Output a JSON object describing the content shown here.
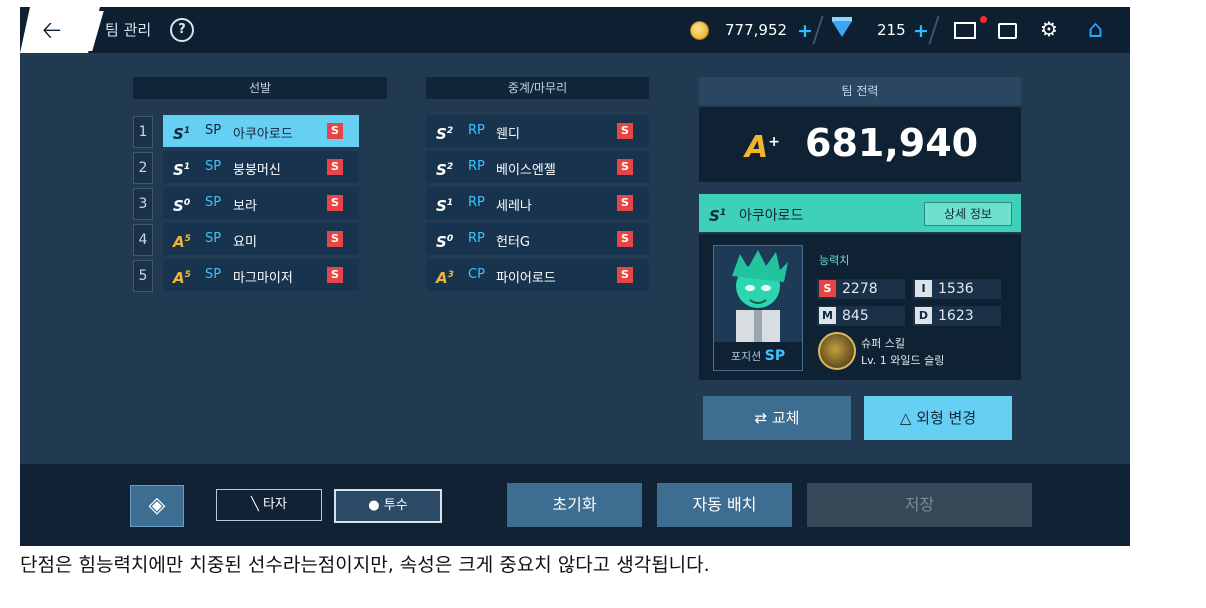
{
  "topbar": {
    "back_icon": "left-arrow-icon",
    "title": "팀 관리",
    "help_label": "?",
    "coins": "777,952",
    "gems": "215",
    "plus": "+",
    "icons": [
      "coin-icon",
      "gem-icon",
      "mail-icon",
      "chat-icon",
      "gear-icon",
      "home-icon"
    ]
  },
  "starters": {
    "header": "선발",
    "rows": [
      {
        "num": "1",
        "grade": "S",
        "grade_level": "1",
        "pos": "SP",
        "name": "아쿠아로드",
        "badge": "S",
        "selected": true
      },
      {
        "num": "2",
        "grade": "S",
        "grade_level": "1",
        "pos": "SP",
        "name": "붕붕머신",
        "badge": "S",
        "selected": false
      },
      {
        "num": "3",
        "grade": "S",
        "grade_level": "0",
        "pos": "SP",
        "name": "보라",
        "badge": "S",
        "selected": false
      },
      {
        "num": "4",
        "grade": "A",
        "grade_level": "5",
        "pos": "SP",
        "name": "요미",
        "badge": "S",
        "selected": false
      },
      {
        "num": "5",
        "grade": "A",
        "grade_level": "5",
        "pos": "SP",
        "name": "마그마이저",
        "badge": "S",
        "selected": false
      }
    ]
  },
  "relievers": {
    "header": "중계/마무리",
    "rows": [
      {
        "grade": "S",
        "grade_level": "2",
        "pos": "RP",
        "name": "웬디",
        "badge": "S"
      },
      {
        "grade": "S",
        "grade_level": "2",
        "pos": "RP",
        "name": "베이스엔젤",
        "badge": "S"
      },
      {
        "grade": "S",
        "grade_level": "1",
        "pos": "RP",
        "name": "세레나",
        "badge": "S"
      },
      {
        "grade": "S",
        "grade_level": "0",
        "pos": "RP",
        "name": "헌터G",
        "badge": "S"
      },
      {
        "grade": "A",
        "grade_level": "3",
        "pos": "CP",
        "name": "파이어로드",
        "badge": "S"
      }
    ]
  },
  "team_power": {
    "header": "팀 전력",
    "grade": "A",
    "grade_suffix": "+",
    "value": "681,940"
  },
  "player": {
    "grade": "S",
    "grade_level": "1",
    "name": "아쿠아로드",
    "detail_button": "상세 정보",
    "position_label": "포지션",
    "position": "SP",
    "stats_label": "능력치",
    "stats": [
      {
        "key": "S",
        "value": "2278"
      },
      {
        "key": "I",
        "value": "1536"
      },
      {
        "key": "M",
        "value": "845"
      },
      {
        "key": "D",
        "value": "1623"
      }
    ],
    "skill_title": "슈퍼 스킬",
    "skill_desc": "Lv. 1 와일드 슬링"
  },
  "actions": {
    "swap": "교체",
    "appearance": "외형 변경"
  },
  "bottom": {
    "batter": "타자",
    "pitcher": "투수",
    "reset": "초기화",
    "auto": "자동 배치",
    "save": "저장"
  },
  "caption": "단점은 힘능력치에만 치중된 선수라는점이지만, 속성은 크게 중요치 않다고 생각됩니다.",
  "colors": {
    "bg": "#213a52",
    "accent": "#66d0f4",
    "selected": "#66d0f4",
    "teal": "#3fd0b8",
    "badge_red": "#e64545",
    "gold": "#f2b52e"
  }
}
